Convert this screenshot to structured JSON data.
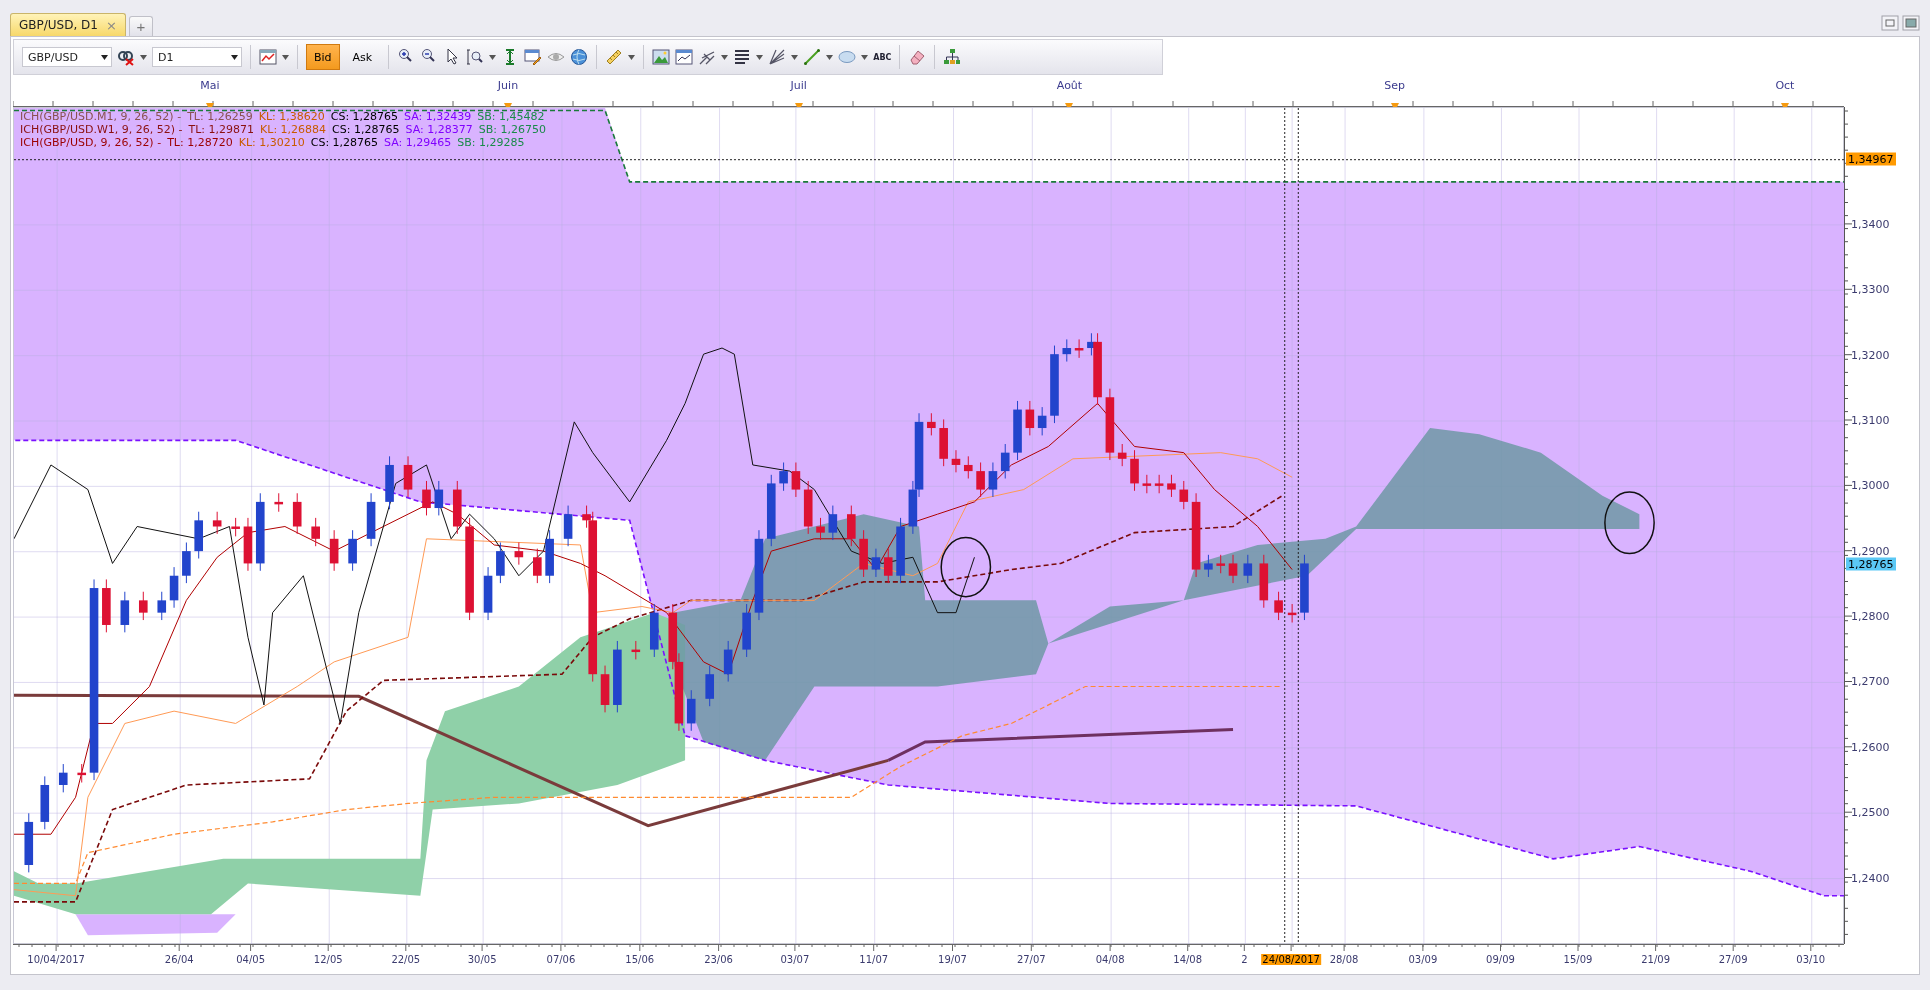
{
  "tabs": [
    {
      "title": "GBP/USD, D1",
      "close": "×",
      "selected": true
    }
  ],
  "new_tab": "+",
  "toolbar": {
    "symbol": "GBP/USD",
    "timeframe": "D1",
    "price_sides": [
      {
        "label": "Bid",
        "selected": true
      },
      {
        "label": "Ask",
        "selected": false
      }
    ],
    "text_tool": "ABC"
  },
  "months": [
    "Mai",
    "Juin",
    "Juil",
    "Août",
    "Sep",
    "Oct"
  ],
  "legend": [
    {
      "name": "ICH(GBP/USD.M1, 9, 26, 52) -",
      "color": "#8a5050",
      "values": [
        {
          "text": "TL: 1,26259",
          "color": "#8a5050"
        },
        {
          "text": "KL: 1,38620",
          "color": "#c85a00"
        },
        {
          "text": "CS: 1,28765",
          "color": "#000000"
        },
        {
          "text": "SA: 1,32439",
          "color": "#8000ff"
        },
        {
          "text": "SB: 1,45482",
          "color": "#1a8a4a"
        }
      ]
    },
    {
      "name": "ICH(GBP/USD.W1, 9, 26, 52) -",
      "color": "#8b1010",
      "values": [
        {
          "text": "TL: 1,29871",
          "color": "#8b1010"
        },
        {
          "text": "KL: 1,26884",
          "color": "#c85a00"
        },
        {
          "text": "CS: 1,28765",
          "color": "#000000"
        },
        {
          "text": "SA: 1,28377",
          "color": "#8000ff"
        },
        {
          "text": "SB: 1,26750",
          "color": "#1a8a4a"
        }
      ]
    },
    {
      "name": "ICH(GBP/USD, 9, 26, 52) -",
      "color": "#9b0000",
      "values": [
        {
          "text": "TL: 1,28720",
          "color": "#9b0000"
        },
        {
          "text": "KL: 1,30210",
          "color": "#c85a00"
        },
        {
          "text": "CS: 1,28765",
          "color": "#000000"
        },
        {
          "text": "SA: 1,29465",
          "color": "#8000ff"
        },
        {
          "text": "SB: 1,29285",
          "color": "#1a8a4a"
        }
      ]
    }
  ],
  "price_axis": [
    {
      "label": "1,34967",
      "kind": "crosshair"
    },
    {
      "label": "1,3400",
      "kind": "tick"
    },
    {
      "label": "1,3300",
      "kind": "tick"
    },
    {
      "label": "1,3200",
      "kind": "tick"
    },
    {
      "label": "1,3100",
      "kind": "tick"
    },
    {
      "label": "1,3000",
      "kind": "tick"
    },
    {
      "label": "1,2900",
      "kind": "tick"
    },
    {
      "label": "1,28765",
      "kind": "last"
    },
    {
      "label": "1,2800",
      "kind": "tick"
    },
    {
      "label": "1,2700",
      "kind": "tick"
    },
    {
      "label": "1,2600",
      "kind": "tick"
    },
    {
      "label": "1,2500",
      "kind": "tick"
    },
    {
      "label": "1,2400",
      "kind": "tick"
    }
  ],
  "date_axis": [
    {
      "label": "10/04/2017",
      "kind": "tick"
    },
    {
      "label": "26/04",
      "kind": "tick"
    },
    {
      "label": "04/05",
      "kind": "tick"
    },
    {
      "label": "12/05",
      "kind": "tick"
    },
    {
      "label": "22/05",
      "kind": "tick"
    },
    {
      "label": "30/05",
      "kind": "tick"
    },
    {
      "label": "07/06",
      "kind": "tick"
    },
    {
      "label": "15/06",
      "kind": "tick"
    },
    {
      "label": "23/06",
      "kind": "tick"
    },
    {
      "label": "03/07",
      "kind": "tick"
    },
    {
      "label": "11/07",
      "kind": "tick"
    },
    {
      "label": "19/07",
      "kind": "tick"
    },
    {
      "label": "27/07",
      "kind": "tick"
    },
    {
      "label": "04/08",
      "kind": "tick"
    },
    {
      "label": "14/08",
      "kind": "tick"
    },
    {
      "label": "2",
      "kind": "tick"
    },
    {
      "label": "24/08/2017",
      "kind": "crosshair"
    },
    {
      "label": "28/08",
      "kind": "tick"
    },
    {
      "label": "03/09",
      "kind": "tick"
    },
    {
      "label": "09/09",
      "kind": "tick"
    },
    {
      "label": "15/09",
      "kind": "tick"
    },
    {
      "label": "21/09",
      "kind": "tick"
    },
    {
      "label": "27/09",
      "kind": "tick"
    },
    {
      "label": "03/10",
      "kind": "tick"
    }
  ]
}
